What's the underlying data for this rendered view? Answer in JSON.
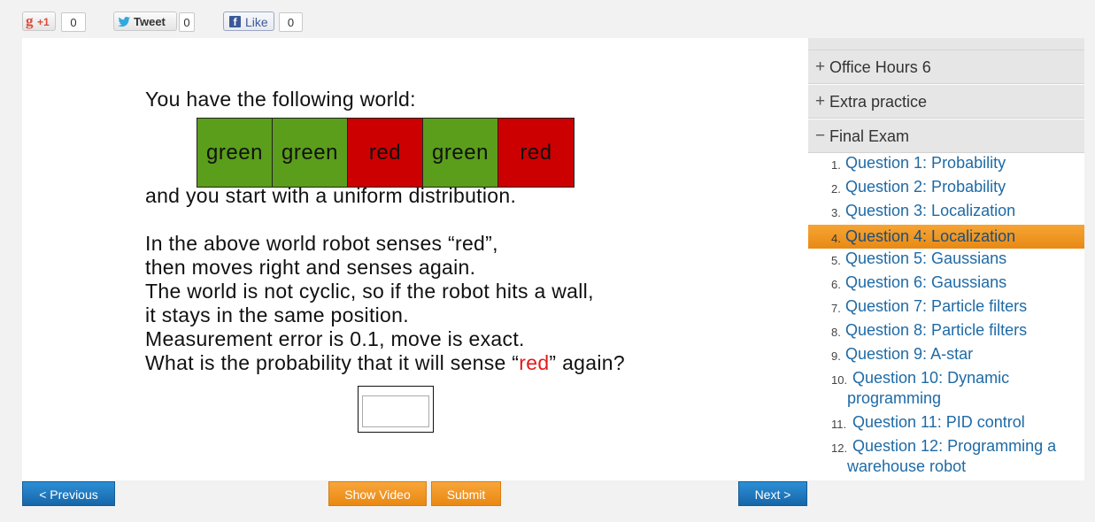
{
  "social": {
    "gplus_label": "+1",
    "gplus_letter": "g",
    "gplus_count": "0",
    "tweet_label": "Tweet",
    "tweet_count": "0",
    "like_label": "Like",
    "like_count": "0"
  },
  "question": {
    "intro": "You have the following world:",
    "world": [
      {
        "label": "green",
        "color": "#5a9e1b"
      },
      {
        "label": "green",
        "color": "#5a9e1b"
      },
      {
        "label": "red",
        "color": "#cc0000"
      },
      {
        "label": "green",
        "color": "#5a9e1b"
      },
      {
        "label": "red",
        "color": "#cc0000"
      }
    ],
    "after_world": "and you start with a uniform distribution.",
    "line1": "In the above world robot senses “red”,",
    "line2": "then moves right and senses again.",
    "line3": "The world is not cyclic, so if the robot hits a wall,",
    "line4": "it stays in the same position.",
    "line5": "Measurement error is 0.1, move is exact.",
    "line6_prefix": "What is the probability that it will sense “",
    "line6_red": "red",
    "line6_suffix": "” again?",
    "answer_value": ""
  },
  "buttons": {
    "previous": "< Previous",
    "show_video": "Show Video",
    "submit": "Submit",
    "next": "Next >"
  },
  "sidebar": {
    "sections": [
      {
        "sign": "+",
        "label": "Office Hours 6"
      },
      {
        "sign": "+",
        "label": "Extra practice"
      },
      {
        "sign": "−",
        "label": "Final Exam"
      }
    ],
    "items": [
      {
        "num": "1.",
        "label": "Question 1: Probability",
        "active": false
      },
      {
        "num": "2.",
        "label": "Question 2: Probability",
        "active": false
      },
      {
        "num": "3.",
        "label": "Question 3: Localization",
        "active": false
      },
      {
        "num": "4.",
        "label": "Question 4: Localization",
        "active": true
      },
      {
        "num": "5.",
        "label": "Question 5: Gaussians",
        "active": false
      },
      {
        "num": "6.",
        "label": "Question 6: Gaussians",
        "active": false
      },
      {
        "num": "7.",
        "label": "Question 7: Particle filters",
        "active": false
      },
      {
        "num": "8.",
        "label": "Question 8: Particle filters",
        "active": false
      },
      {
        "num": "9.",
        "label": "Question 9: A-star",
        "active": false
      },
      {
        "num": "10.",
        "label": "Question 10: Dynamic",
        "label2": "programming",
        "active": false
      },
      {
        "num": "11.",
        "label": "Question 11: PID control",
        "active": false
      },
      {
        "num": "12.",
        "label": "Question 12: Programming a",
        "label2": "warehouse robot",
        "active": false
      }
    ],
    "accent": "#e98812",
    "link_color": "#1e6aa6"
  }
}
